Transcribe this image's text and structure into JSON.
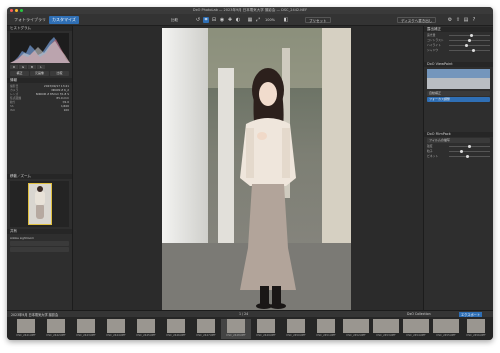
{
  "window": {
    "title": "DxO PhotoLab — 2023年9月 日本電気大学 撮影会 — DSC_2442.NEF"
  },
  "toolbar": {
    "tab_library": "フォトライブラリ",
    "tab_customize": "カスタマイズ",
    "compare_label": "比較",
    "zoom_label": "100%",
    "presets_label": "プリセット",
    "export_label": "エクスポート",
    "disk_button": "ディスクへ書き出し"
  },
  "left_panel": {
    "histogram_title": "ヒストグラム",
    "rgb": [
      "R",
      "G",
      "B",
      "L"
    ],
    "buttons": [
      "補正",
      "元画像",
      "比較"
    ],
    "info_title": "情報",
    "info_rows": [
      {
        "k": "撮影日",
        "v": "2023/09/17 13:41"
      },
      {
        "k": "カメラ",
        "v": "NIKON Z 6_2"
      },
      {
        "k": "レンズ",
        "v": "NIKKOR Z 85mm f/1.8 S"
      },
      {
        "k": "焦点距離",
        "v": "85.0 mm"
      },
      {
        "k": "絞り",
        "v": "f/2.0"
      },
      {
        "k": "SS",
        "v": "1/400"
      },
      {
        "k": "ISO",
        "v": "100"
      }
    ],
    "navigator_title": "移動／ズーム",
    "sharing_title": "共有",
    "sharing_label": "Adobe Lightroom"
  },
  "right_panel": {
    "head_light": "露出補正",
    "sliders": [
      {
        "label": "露光量",
        "value": 0.55
      },
      {
        "label": "コントラスト",
        "value": 0.5
      },
      {
        "label": "ハイライト",
        "value": 0.42
      },
      {
        "label": "シャドウ",
        "value": 0.6
      }
    ],
    "head_viewpoint": "DxO ViewPoint",
    "viewpoint_select": "自動補正",
    "viewpoint_button": "フォーカス調整",
    "head_filmpack": "DxO FilmPack",
    "filmpack_select": "フィルムの描写",
    "detail_sliders": [
      {
        "label": "強度",
        "value": 0.5
      },
      {
        "label": "粒子",
        "value": 0.3
      },
      {
        "label": "ビネット",
        "value": 0.45
      }
    ]
  },
  "filmstrip": {
    "path": "2023年9月 日本電気大学 撮影会",
    "count": "1 / 24",
    "view_label": "DxO Collection",
    "export_button": "エクスポート",
    "items": [
      "DSC_2441.NEF",
      "DSC_2442.NEF",
      "DSC_2443.NEF",
      "DSC_2444.NEF",
      "DSC_2445.NEF",
      "DSC_2446.NEF",
      "DSC_2447.NEF",
      "DSC_2448.NEF",
      "DSC_2449.NEF",
      "DSC_2450.NEF",
      "DSC_2451.NEF",
      "DSC_2452.NEF",
      "DSC_2453.NEF",
      "DSC_2454.NEF",
      "DSC_2455.NEF",
      "DSC_2456.NEF"
    ],
    "selected_index": 7
  },
  "colors": {
    "accent": "#2f6fb5",
    "panel": "#2e2e2e",
    "background": "#2b2b2b"
  }
}
